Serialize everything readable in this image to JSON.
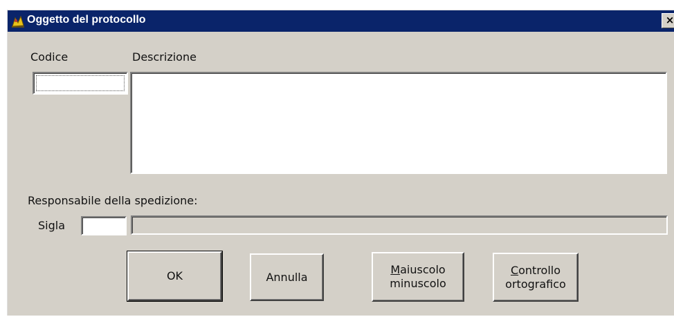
{
  "window": {
    "title": "Oggetto del protocollo",
    "title_icon": "app-icon",
    "close_glyph": "×"
  },
  "form": {
    "codice_label": "Codice",
    "descrizione_label": "Descrizione",
    "codice_value": "",
    "descrizione_value": "",
    "responsabile_label": "Responsabile della spedizione:",
    "sigla_label": "Sigla",
    "sigla_value": "",
    "responsabile_value": ""
  },
  "buttons": {
    "ok": "OK",
    "annulla": "Annulla",
    "maiuscolo_line1_mnemonic": "M",
    "maiuscolo_line1_rest": "aiuscolo",
    "maiuscolo_line2": "minuscolo",
    "controllo_line1_mnemonic": "C",
    "controllo_line1_rest": "ontrollo",
    "controllo_line2": "ortografico"
  },
  "colors": {
    "titlebar": "#0a246a",
    "face": "#d4d0c8",
    "field": "#ffffff"
  }
}
